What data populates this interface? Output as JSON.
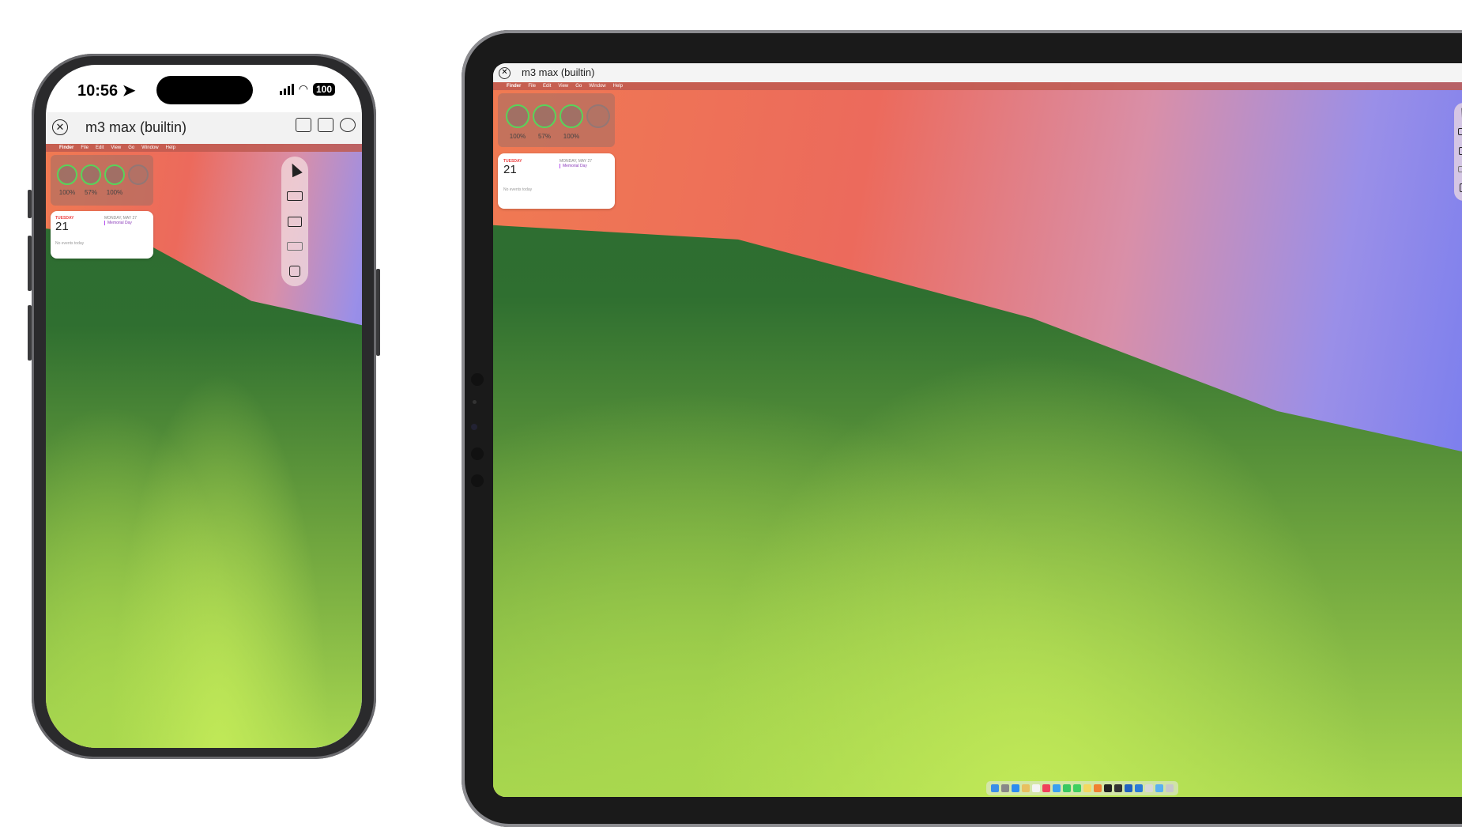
{
  "phone": {
    "status": {
      "time": "10:56",
      "battery": "100"
    },
    "window_title": "m3 max (builtin)",
    "close_glyph": "✕"
  },
  "tablet": {
    "window_title": "m3 max (builtin)",
    "close_glyph": "✕"
  },
  "menubar": [
    "Finder",
    "File",
    "Edit",
    "View",
    "Go",
    "Window",
    "Help"
  ],
  "battery_widget": {
    "devices": [
      {
        "icon": "laptop-icon",
        "percent": "100%"
      },
      {
        "icon": "phone-icon",
        "percent": "57%"
      },
      {
        "icon": "mouse-icon",
        "percent": "100%"
      },
      {
        "icon": "empty-slot",
        "percent": ""
      }
    ]
  },
  "calendar": {
    "weekday": "TUESDAY",
    "day_number": "21",
    "next_date": "MONDAY, MAY 27",
    "event": "Memorial Day",
    "empty_text": "No events today"
  },
  "toolbar_icons": [
    "pointer-icon",
    "keyboard-icon",
    "display-icon",
    "laptop-icon",
    "lock-icon"
  ],
  "colors": {
    "ring": "#58d45a",
    "event": "#b44cf0",
    "weekday": "#e44444"
  }
}
